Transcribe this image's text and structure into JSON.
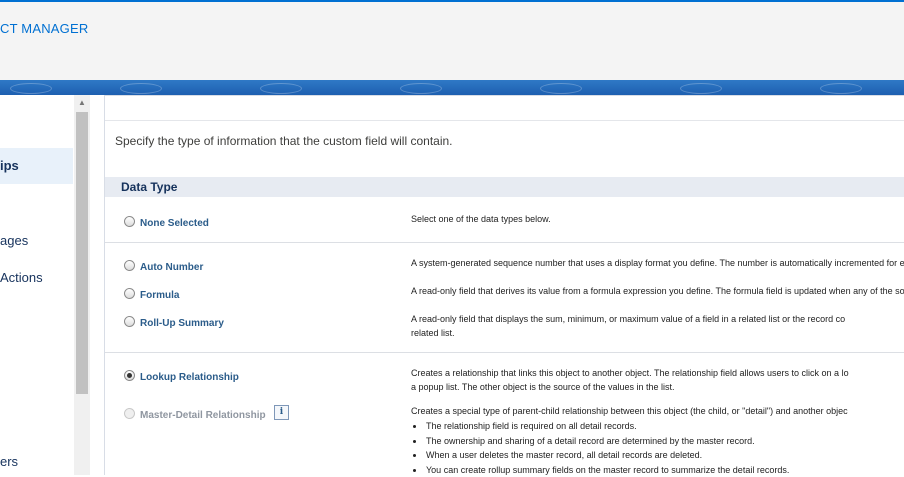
{
  "header": {
    "title": "CT MANAGER"
  },
  "sidebar": {
    "items": [
      {
        "label": "ips",
        "active": true
      },
      {
        "label": "ages",
        "active": false
      },
      {
        "label": "Actions",
        "active": false
      },
      {
        "label": "ers",
        "active": false
      }
    ]
  },
  "main": {
    "intro": "Specify the type of information that the custom field will contain.",
    "section_title": "Data Type",
    "options": {
      "none": {
        "label": "None Selected",
        "description": "Select one of the data types below."
      },
      "auto_number": {
        "label": "Auto Number",
        "description": "A system-generated sequence number that uses a display format you define. The number is automatically incremented for each new record."
      },
      "formula": {
        "label": "Formula",
        "description": "A read-only field that derives its value from a formula expression you define. The formula field is updated when any of the source fields change."
      },
      "rollup": {
        "label": "Roll-Up Summary",
        "description_line1": "A read-only field that displays the sum, minimum, or maximum value of a field in a related list or the record co",
        "description_line2": "related list."
      },
      "lookup": {
        "label": "Lookup Relationship",
        "checked": true,
        "description_line1": "Creates a relationship that links this object to another object. The relationship field allows users to click on a lo",
        "description_line2": "a popup list. The other object is the source of the values in the list."
      },
      "master_detail": {
        "label": "Master-Detail Relationship",
        "disabled": true,
        "description": "Creates a special type of parent-child relationship between this object (the child, or \"detail\") and another objec",
        "bullets": [
          "The relationship field is required on all detail records.",
          "The ownership and sharing of a detail record are determined by the master record.",
          "When a user deletes the master record, all detail records are deleted.",
          "You can create rollup summary fields on the master record to summarize the detail records."
        ]
      }
    }
  },
  "icons": {
    "info": "i",
    "scroll_up": "▲"
  },
  "colors": {
    "brand": "#0070d2",
    "link": "#2b5c8a",
    "section_bg": "#e7ebf2"
  }
}
